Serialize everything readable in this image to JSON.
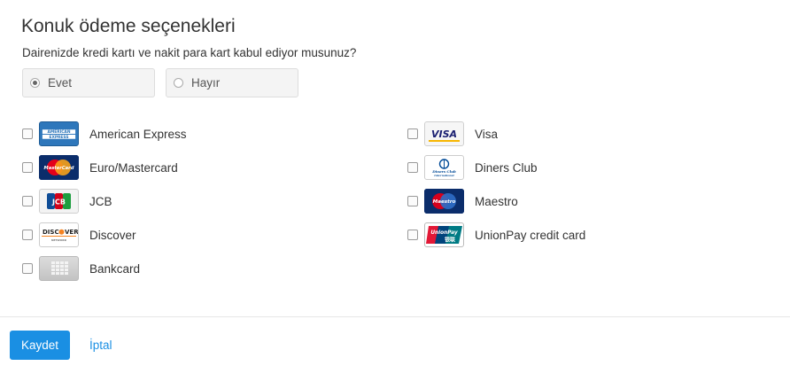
{
  "title": "Konuk ödeme seçenekleri",
  "question": "Dairenizde kredi kartı ve nakit para kart kabul ediyor musunuz?",
  "radio": {
    "yes_label": "Evet",
    "no_label": "Hayır",
    "selected": "yes"
  },
  "cards_left": [
    {
      "label": "American Express",
      "icon": "amex-logo",
      "checked": false
    },
    {
      "label": "Euro/Mastercard",
      "icon": "mastercard-logo",
      "checked": false
    },
    {
      "label": "JCB",
      "icon": "jcb-logo",
      "checked": false
    },
    {
      "label": "Discover",
      "icon": "discover-logo",
      "checked": false
    },
    {
      "label": "Bankcard",
      "icon": "bankcard-logo",
      "checked": false
    }
  ],
  "cards_right": [
    {
      "label": "Visa",
      "icon": "visa-logo",
      "checked": false
    },
    {
      "label": "Diners Club",
      "icon": "diners-club-logo",
      "checked": false
    },
    {
      "label": "Maestro",
      "icon": "maestro-logo",
      "checked": false
    },
    {
      "label": "UnionPay credit card",
      "icon": "unionpay-logo",
      "checked": false
    }
  ],
  "logos": {
    "amex": "AMERICAN EXPRESS",
    "visa": "VISA",
    "mastercard": "MasterCard",
    "jcb": "JCB",
    "diners": "Diners Club International",
    "maestro": "Maestro",
    "discover": "DISCOVER NETWORK",
    "unionpay": "UnionPay 银联"
  },
  "actions": {
    "save_label": "Kaydet",
    "cancel_label": "İptal"
  },
  "colors": {
    "accent": "#1a8fe3"
  }
}
